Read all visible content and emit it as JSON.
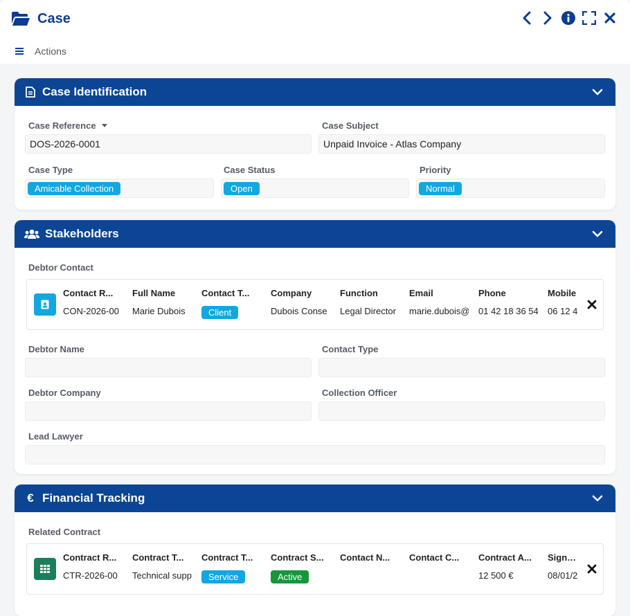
{
  "header": {
    "title": "Case",
    "actions_label": "Actions",
    "icons": [
      "folder-open-icon",
      "chevron-left-icon",
      "chevron-right-icon",
      "info-icon",
      "fullscreen-icon",
      "close-icon",
      "hamburger-menu-icon"
    ]
  },
  "colors": {
    "primary": "#0b4594",
    "badge_blue": "#12a7e0",
    "badge_green": "#17963b",
    "contract_avatar": "#1a7f5a"
  },
  "identification": {
    "title": "Case Identification",
    "case_reference_label": "Case Reference",
    "case_reference_value": "DOS-2026-0001",
    "case_subject_label": "Case Subject",
    "case_subject_value": "Unpaid Invoice - Atlas Company",
    "case_type_label": "Case Type",
    "case_type_value": "Amicable Collection",
    "case_status_label": "Case Status",
    "case_status_value": "Open",
    "priority_label": "Priority",
    "priority_value": "Normal"
  },
  "stakeholders": {
    "title": "Stakeholders",
    "debtor_contact_label": "Debtor Contact",
    "contact_card": {
      "headers": [
        "Contact R...",
        "Full Name",
        "Contact T...",
        "Company",
        "Function",
        "Email",
        "Phone",
        "Mobile"
      ],
      "values": [
        "CON-2026-00",
        "Marie Dubois",
        "Client",
        "Dubois Conse",
        "Legal Director",
        "marie.dubois@",
        "01 42 18 36 54",
        "06 12 4"
      ]
    },
    "debtor_name_label": "Debtor Name",
    "debtor_name_value": "",
    "contact_type_label": "Contact Type",
    "contact_type_value": "",
    "debtor_company_label": "Debtor Company",
    "debtor_company_value": "",
    "collection_officer_label": "Collection Officer",
    "collection_officer_value": "",
    "lead_lawyer_label": "Lead Lawyer",
    "lead_lawyer_value": ""
  },
  "financial": {
    "title": "Financial Tracking",
    "icon_symbol": "€",
    "related_contract_label": "Related Contract",
    "contract_card": {
      "headers": [
        "Contract R...",
        "Contract T...",
        "Contract T...",
        "Contract S...",
        "Contact N...",
        "Contact C...",
        "Contract A...",
        "Signatu"
      ],
      "values": [
        "CTR-2026-00",
        "Technical supp",
        "Service",
        "Active",
        "",
        "",
        "12 500 €",
        "08/01/2"
      ]
    }
  }
}
